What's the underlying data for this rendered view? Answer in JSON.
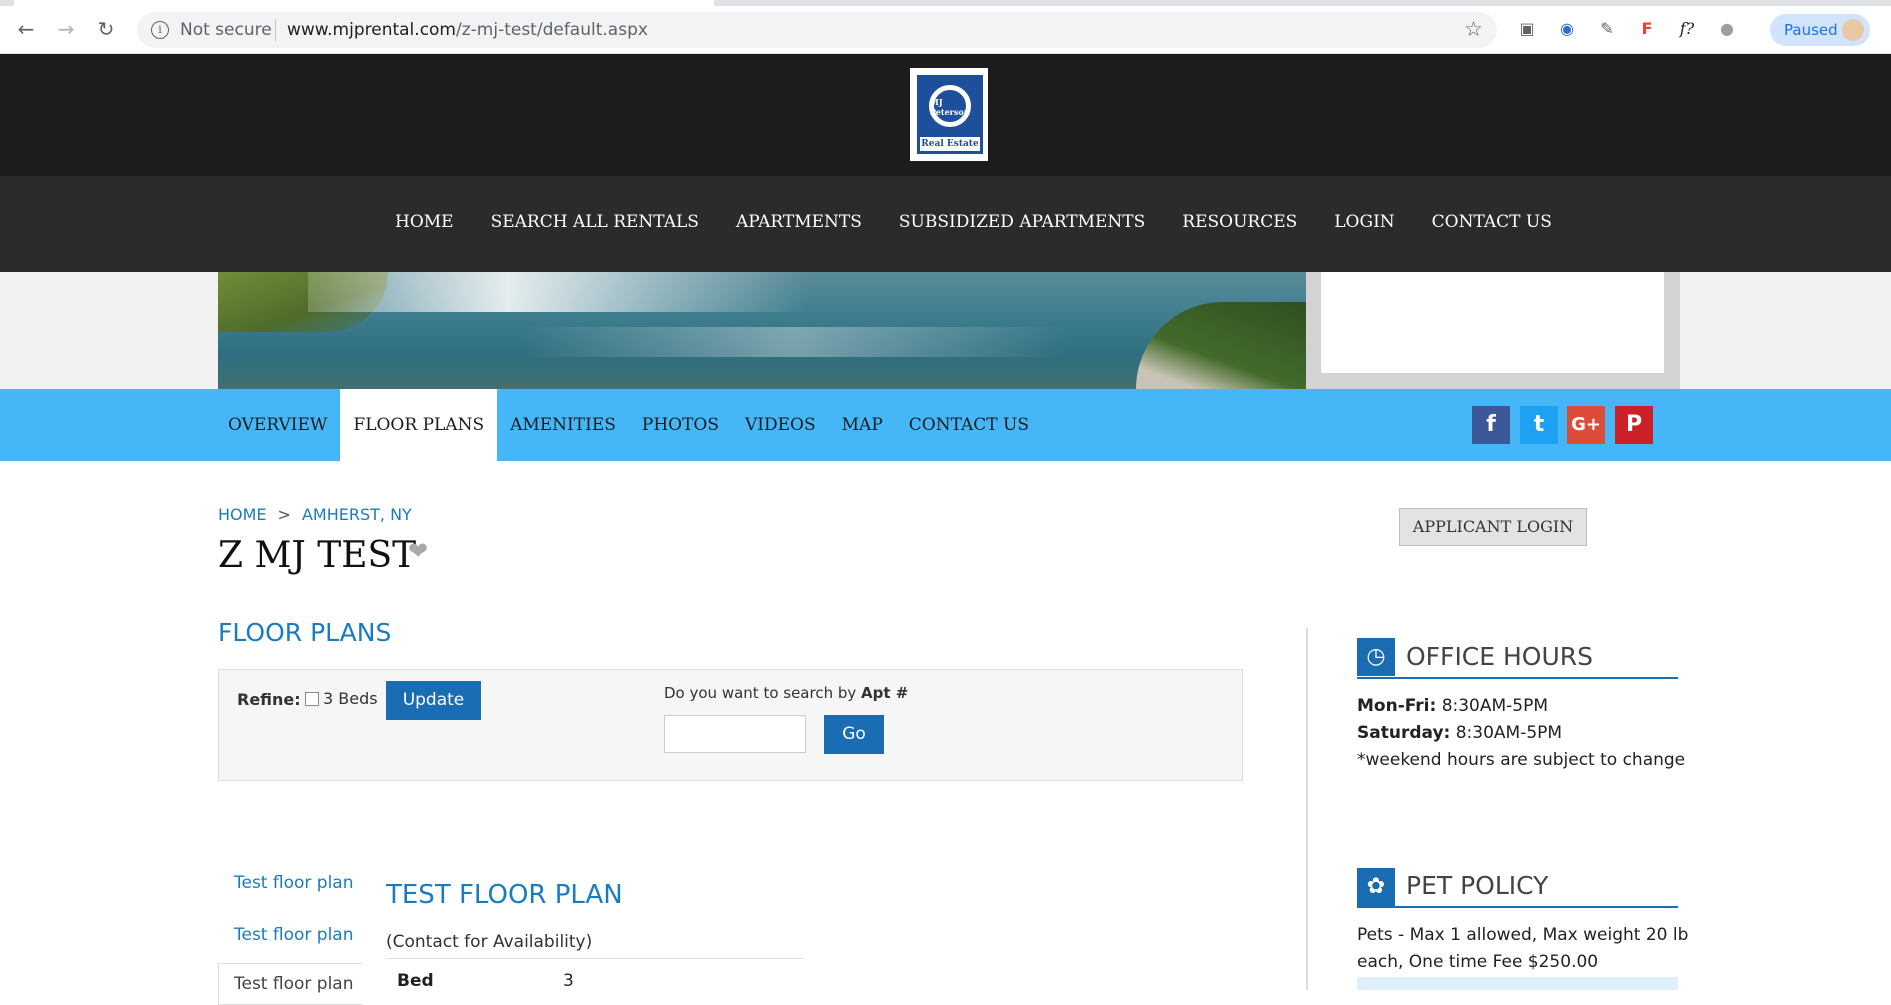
{
  "browser": {
    "not_secure": "Not secure",
    "url_host": "www.mjprental.com",
    "url_path": "/z-mj-test/default.aspx",
    "paused": "Paused"
  },
  "logo": {
    "mark": "MJ Peterson",
    "text": "Real Estate"
  },
  "main_nav": [
    "HOME",
    "SEARCH ALL RENTALS",
    "APARTMENTS",
    "SUBSIDIZED APARTMENTS",
    "RESOURCES",
    "LOGIN",
    "CONTACT US"
  ],
  "sub_nav": {
    "items": [
      "OVERVIEW",
      "FLOOR PLANS",
      "AMENITIES",
      "PHOTOS",
      "VIDEOS",
      "MAP",
      "CONTACT US"
    ],
    "active": "FLOOR PLANS"
  },
  "social": {
    "facebook": "f",
    "twitter": "t",
    "googleplus": "G+",
    "pinterest": "P",
    "colors": {
      "facebook": "#3b5998",
      "twitter": "#1da1f2",
      "googleplus": "#dd4b39",
      "pinterest": "#cb2027"
    }
  },
  "breadcrumb": {
    "home": "HOME",
    "separator": ">",
    "city": "AMHERST, NY"
  },
  "property": {
    "title": "Z MJ TEST"
  },
  "applicant_login": "APPLICANT LOGIN",
  "floor_plans": {
    "heading": "FLOOR PLANS",
    "refine_label": "Refine:",
    "beds_option": "3 Beds",
    "update_button": "Update",
    "apt_question": "Do you want to search by ",
    "apt_question_bold": "Apt #",
    "apt_input_value": "",
    "go_button": "Go",
    "tabs": [
      "Test floor plan",
      "Test floor plan",
      "Test floor plan"
    ],
    "selected_plan": {
      "title": "TEST FLOOR PLAN",
      "availability": "(Contact for Availability)",
      "bed_label": "Bed",
      "bed_value": "3"
    }
  },
  "office_hours": {
    "title": "OFFICE HOURS",
    "weekday_label": "Mon-Fri:",
    "weekday_hours": " 8:30AM-5PM",
    "saturday_label": "Saturday:",
    "saturday_hours": " 8:30AM-5PM",
    "note": "*weekend hours are subject to change"
  },
  "pet_policy": {
    "title": "PET POLICY",
    "line1": "Pets - Max 1 allowed, Max weight 20 lb",
    "line2": "each, One time Fee $250.00"
  },
  "colors": {
    "accent_blue": "#1a7cc0",
    "button_blue": "#1a6db3",
    "subnav_bg": "#45b7f8",
    "header_dark": "#1c1c1c"
  }
}
